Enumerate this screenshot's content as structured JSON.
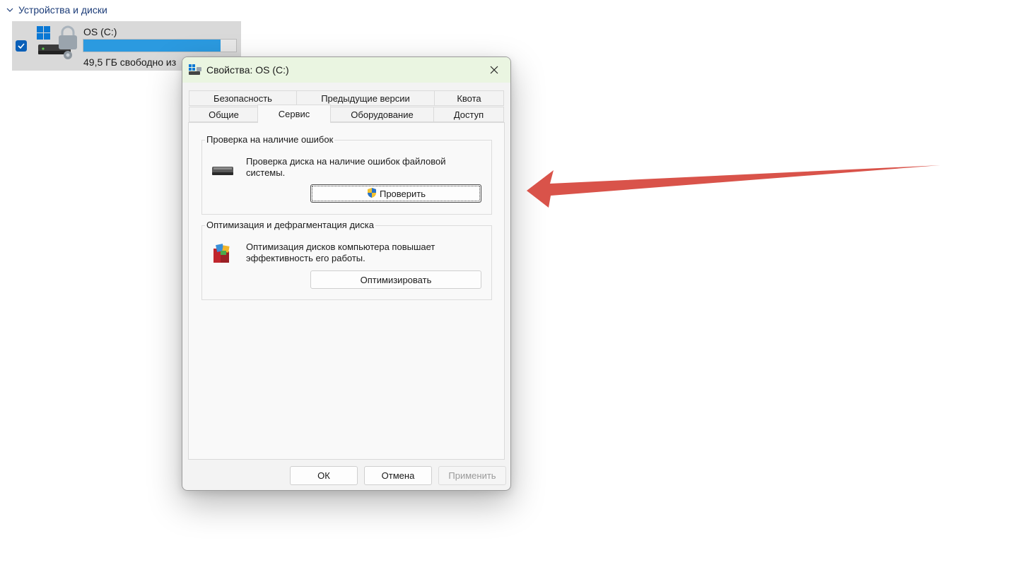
{
  "section": {
    "title": "Устройства и диски"
  },
  "drive": {
    "name": "OS (C:)",
    "free_text": "49,5 ГБ свободно из",
    "usage_fraction": 0.9,
    "bar_color": "#2b9ae0",
    "icon": "drive-lock-icon"
  },
  "dialog": {
    "title": "Свойства: OS (C:)",
    "tabs_row1": [
      "Безопасность",
      "Предыдущие версии",
      "Квота"
    ],
    "tabs_row2": [
      "Общие",
      "Сервис",
      "Оборудование",
      "Доступ"
    ],
    "active_tab": "Сервис",
    "error_check": {
      "title": "Проверка на наличие ошибок",
      "description": "Проверка диска на наличие ошибок файловой системы.",
      "button": "Проверить",
      "icon": "hard-drive-icon",
      "button_icon": "uac-shield-icon"
    },
    "optimize": {
      "title": "Оптимизация и дефрагментация диска",
      "description": "Оптимизация дисков компьютера повышает эффективность его работы.",
      "button": "Оптимизировать",
      "icon": "defrag-icon"
    },
    "footer": {
      "ok": "ОК",
      "cancel": "Отмена",
      "apply": "Применить"
    }
  },
  "annotation": {
    "color": "#d9534a",
    "points_to": "check-button"
  }
}
